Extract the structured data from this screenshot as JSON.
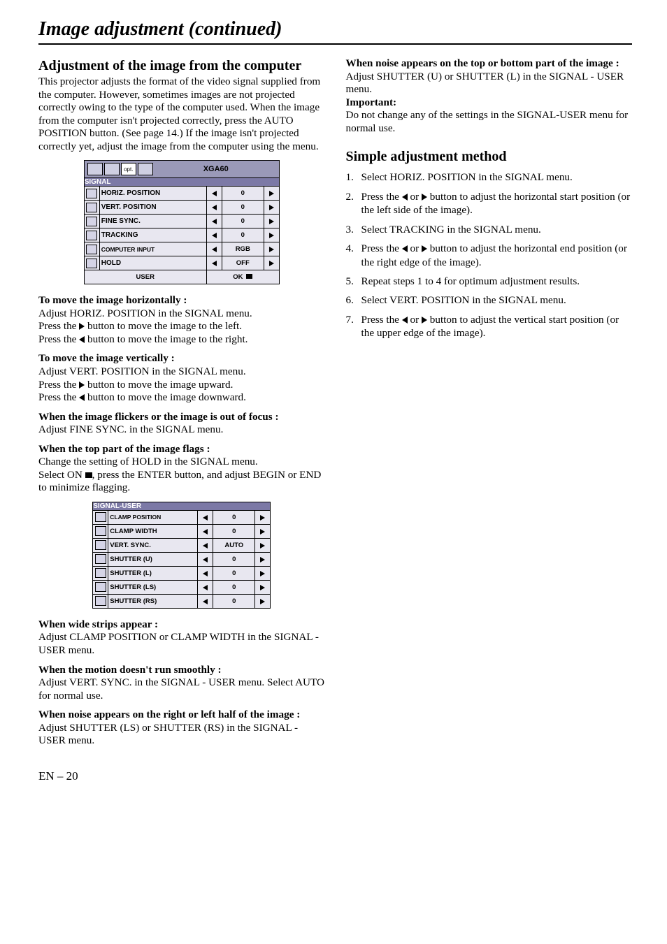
{
  "page": {
    "title": "Image adjustment (continued)",
    "number": "EN – 20"
  },
  "left": {
    "h_adjust": "Adjustment of the image from the computer",
    "p_adjust": "This projector adjusts the format of the video signal supplied from the computer. However, sometimes images are not projected correctly owing to the type of the computer used. When the image from the computer isn't projected correctly, press the AUTO POSITION button. (See page 14.) If the image isn't projected correctly yet, adjust the image from the computer using the menu.",
    "move_h_t": "To move the image horizontally :",
    "move_h_b": "Adjust HORIZ. POSITION in the SIGNAL menu. Press the   button to move the image to the left. Press the   button to move the image to the right.",
    "move_h_l1": "Adjust HORIZ. POSITION in the SIGNAL menu.",
    "move_h_l2a": "Press the ",
    "move_h_l2b": " button to move the image to the left.",
    "move_h_l3a": "Press the ",
    "move_h_l3b": " button to move the image to the right.",
    "move_v_t": "To move the image vertically :",
    "move_v_l1": "Adjust VERT. POSITION in the SIGNAL menu.",
    "move_v_l2a": "Press the ",
    "move_v_l2b": " button to move the image upward.",
    "move_v_l3a": "Press the ",
    "move_v_l3b": " button to move the image downward.",
    "flicker_t": "When the image flickers or the image is out of focus :",
    "flicker_b": "Adjust FINE SYNC. in the SIGNAL menu.",
    "flags_t": "When the top part of the image flags :",
    "flags_l1": "Change the setting of HOLD in the SIGNAL menu.",
    "flags_l2a": "Select ON ",
    "flags_l2b": ", press the ENTER button, and adjust BEGIN or END to minimize flagging.",
    "wide_t": "When wide strips appear :",
    "wide_b": "Adjust CLAMP POSITION or CLAMP WIDTH in the SIGNAL - USER menu.",
    "motion_t": "When the motion doesn't run smoothly :",
    "motion_b": "Adjust VERT. SYNC. in the SIGNAL - USER menu. Select AUTO for normal use.",
    "noise_rl_t": "When noise appears on the right or left half of the image :",
    "noise_rl_b": "Adjust SHUTTER (LS) or SHUTTER (RS) in the SIGNAL - USER menu."
  },
  "right": {
    "noise_tb_t": "When noise appears on the top or bottom part of the image :",
    "noise_tb_b": "Adjust SHUTTER (U) or SHUTTER (L) in the SIGNAL - USER menu.",
    "important_t": "Important:",
    "important_b": "Do not change any of the settings in the SIGNAL-USER menu for normal use.",
    "simple_h": "Simple adjustment method",
    "steps": [
      {
        "n": "1.",
        "t_pre": "Select HORIZ. POSITION in the SIGNAL menu.",
        "arrows": false
      },
      {
        "n": "2.",
        "t_pre": "Press the ",
        "t_mid": " or ",
        "t_post": " button to adjust the horizontal start position (or the left side of the image).",
        "arrows": true
      },
      {
        "n": "3.",
        "t_pre": "Select TRACKING in the SIGNAL menu.",
        "arrows": false
      },
      {
        "n": "4.",
        "t_pre": "Press the ",
        "t_mid": " or ",
        "t_post": " button to adjust the horizontal end position (or the right edge of the image).",
        "arrows": true
      },
      {
        "n": "5.",
        "t_pre": "Repeat steps 1 to 4 for optimum adjustment results.",
        "arrows": false
      },
      {
        "n": "6.",
        "t_pre": "Select VERT. POSITION in the SIGNAL menu.",
        "arrows": false
      },
      {
        "n": "7.",
        "t_pre": "Press the ",
        "t_mid": " or ",
        "t_post": " button to adjust the vertical start position (or the upper edge of the image).",
        "arrows": true
      }
    ]
  },
  "osd1": {
    "res": "XGA60",
    "head": "SIGNAL",
    "rows": [
      {
        "label": "HORIZ. POSITION",
        "val": "0"
      },
      {
        "label": "VERT. POSITION",
        "val": "0"
      },
      {
        "label": "FINE SYNC.",
        "val": "0"
      },
      {
        "label": "TRACKING",
        "val": "0"
      },
      {
        "label": "COMPUTER INPUT",
        "val": "RGB"
      },
      {
        "label": "HOLD",
        "val": "OFF"
      }
    ],
    "foot_l": "USER",
    "foot_r": "OK"
  },
  "osd2": {
    "head": "SIGNAL-USER",
    "rows": [
      {
        "label": "CLAMP POSITION",
        "val": "0"
      },
      {
        "label": "CLAMP WIDTH",
        "val": "0"
      },
      {
        "label": "VERT. SYNC.",
        "val": "AUTO"
      },
      {
        "label": "SHUTTER (U)",
        "val": "0"
      },
      {
        "label": "SHUTTER (L)",
        "val": "0"
      },
      {
        "label": "SHUTTER (LS)",
        "val": "0"
      },
      {
        "label": "SHUTTER (RS)",
        "val": "0"
      }
    ]
  }
}
